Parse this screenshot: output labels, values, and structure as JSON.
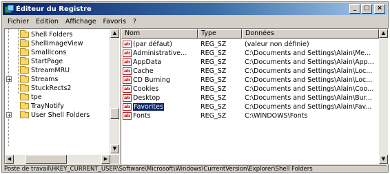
{
  "window": {
    "title": "Éditeur du Registre",
    "controls": [
      "_",
      "□",
      "×"
    ]
  },
  "menu": [
    "Fichier",
    "Edition",
    "Affichage",
    "Favoris",
    "?"
  ],
  "tree": {
    "items": [
      {
        "label": "Shell Folders",
        "expander": ""
      },
      {
        "label": "ShellImageView",
        "expander": ""
      },
      {
        "label": "SmallIcons",
        "expander": ""
      },
      {
        "label": "StartPage",
        "expander": ""
      },
      {
        "label": "StreamMRU",
        "expander": ""
      },
      {
        "label": "Streams",
        "expander": "+"
      },
      {
        "label": "StuckRects2",
        "expander": ""
      },
      {
        "label": "tpe",
        "expander": ""
      },
      {
        "label": "TrayNotify",
        "expander": ""
      },
      {
        "label": "User Shell Folders",
        "expander": "+"
      }
    ]
  },
  "list": {
    "headers": [
      "Nom",
      "Type",
      "Données"
    ],
    "rows": [
      {
        "name": "(par défaut)",
        "type": "REG_SZ",
        "data": "(valeur non définie)"
      },
      {
        "name": "Administrative...",
        "type": "REG_SZ",
        "data": "C:\\Documents and Settings\\Alain\\Me..."
      },
      {
        "name": "AppData",
        "type": "REG_SZ",
        "data": "C:\\Documents and Settings\\Alain\\App..."
      },
      {
        "name": "Cache",
        "type": "REG_SZ",
        "data": "C:\\Documents and Settings\\Alain\\Loc..."
      },
      {
        "name": "CD Burning",
        "type": "REG_SZ",
        "data": "C:\\Documents and Settings\\Alain\\Loc..."
      },
      {
        "name": "Cookies",
        "type": "REG_SZ",
        "data": "C:\\Documents and Settings\\Alain\\Coo..."
      },
      {
        "name": "Desktop",
        "type": "REG_SZ",
        "data": "C:\\Documents and Settings\\Alain\\Bur..."
      },
      {
        "name": "Favorites",
        "type": "REG_SZ",
        "data": "C:\\Documents and Settings\\Alain\\Fav..."
      },
      {
        "name": "Fonts",
        "type": "REG_SZ",
        "data": "C:\\WINDOWS\\Fonts"
      }
    ],
    "icon_text": "ab"
  },
  "status": "Poste de travail\\HKEY_CURRENT_USER\\Software\\Microsoft\\Windows\\CurrentVersion\\Explorer\\Shell Folders",
  "colors": {
    "title_start": "#0a246a",
    "title_end": "#a6caf0",
    "selection": "#0a246a",
    "face": "#d4d0c8"
  }
}
